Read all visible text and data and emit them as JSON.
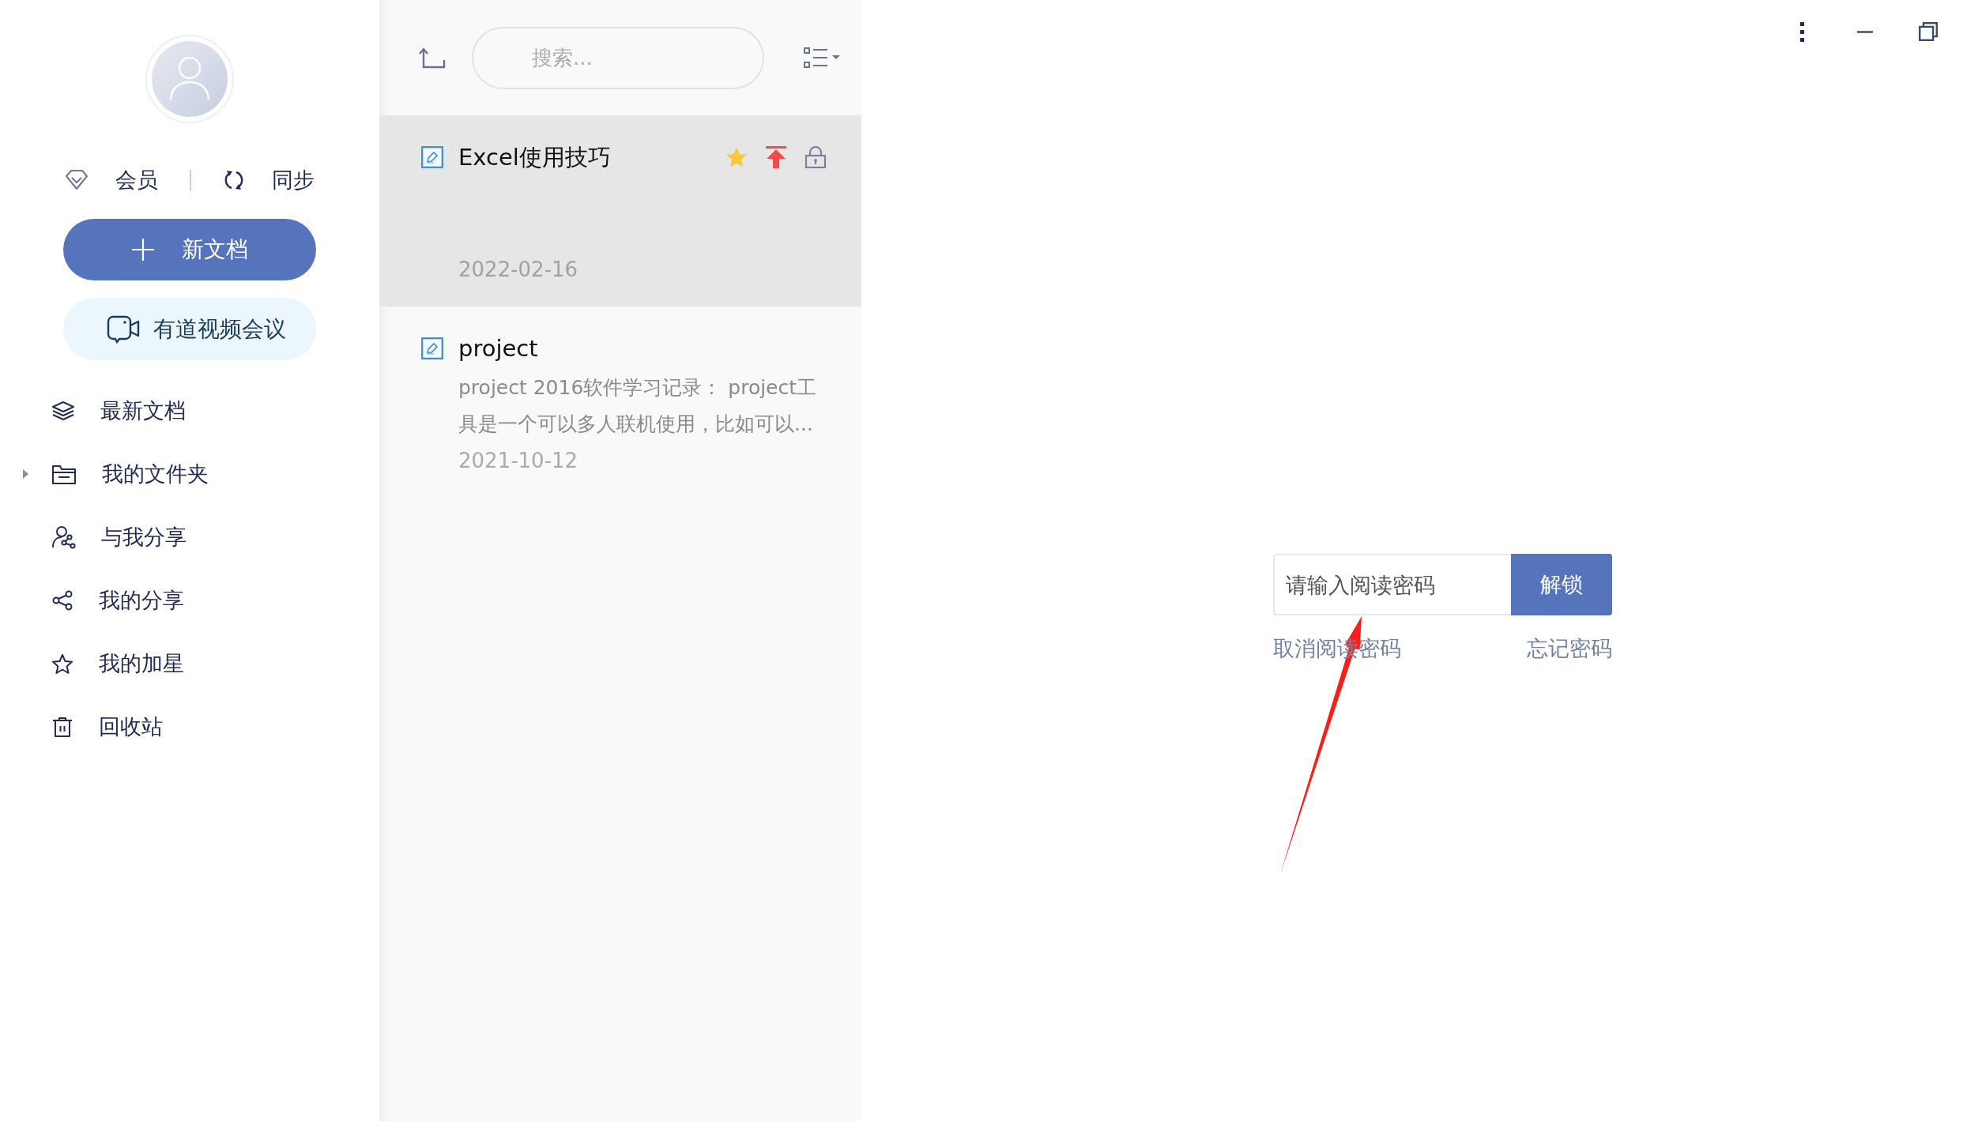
{
  "sidebar": {
    "account_links": [
      {
        "kind": "member",
        "label": "会员"
      },
      {
        "kind": "sync",
        "label": "同步"
      }
    ],
    "new_document_button": {
      "label": "新文档"
    },
    "meeting_button": {
      "label": "有道视频会议"
    },
    "items": [
      {
        "kind": "recent",
        "label": "最新文档"
      },
      {
        "kind": "folder",
        "label": "我的文件夹",
        "expanded": false
      },
      {
        "kind": "shared_with_me",
        "label": "与我分享"
      },
      {
        "kind": "my_shares",
        "label": "我的分享"
      },
      {
        "kind": "starred",
        "label": "我的加星"
      },
      {
        "kind": "trash",
        "label": "回收站"
      }
    ]
  },
  "note_list": {
    "search": {
      "placeholder": "搜索..."
    },
    "notes": [
      {
        "title": "Excel使用技巧",
        "date": "2022-02-16",
        "selected": true,
        "starred": true,
        "pinned": true,
        "locked": true
      },
      {
        "title": "project",
        "preview": "project 2016软件学习记录：  project工具是一个可以多人联机使用，比如可以...",
        "date": "2021-10-12",
        "selected": false,
        "starred": false,
        "pinned": false,
        "locked": false
      }
    ]
  },
  "lock_screen": {
    "password_field": {
      "placeholder": "请输入阅读密码"
    },
    "unlock_button": {
      "label": "解锁"
    },
    "links": [
      {
        "kind": "cancel",
        "label": "取消阅读密码"
      },
      {
        "kind": "forgot",
        "label": "忘记密码"
      }
    ]
  },
  "annotations": [
    {
      "kind": "arrow"
    }
  ]
}
